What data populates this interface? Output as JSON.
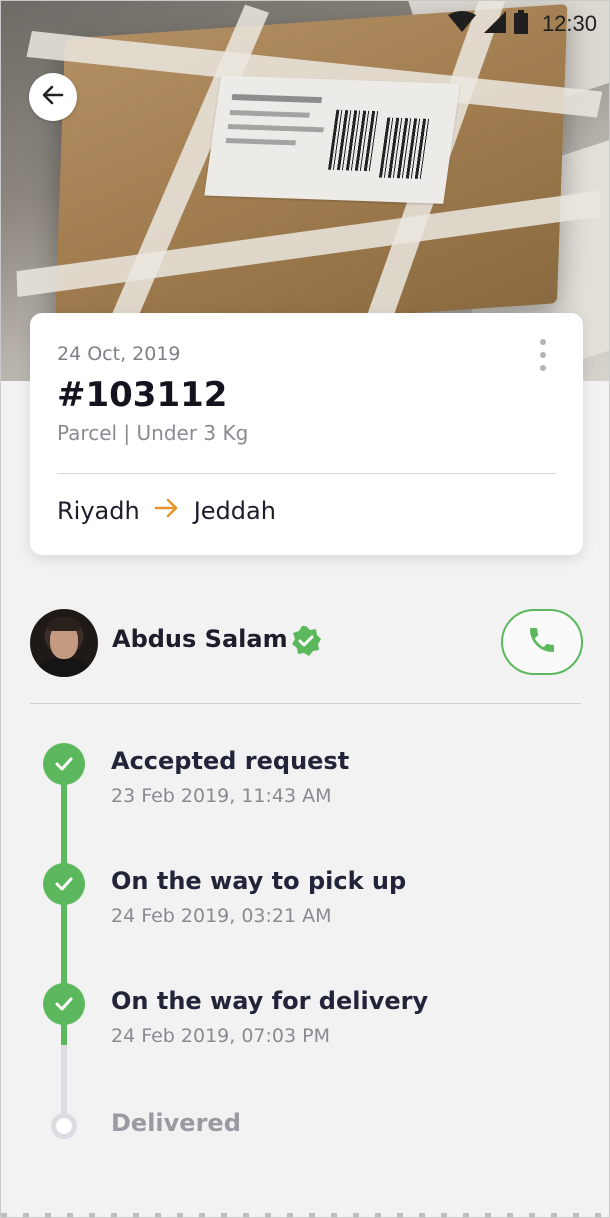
{
  "status_bar": {
    "time": "12:30",
    "icons": [
      "wifi-icon",
      "signal-icon",
      "battery-icon"
    ]
  },
  "header": {
    "back_icon": "arrow-left-icon"
  },
  "shipment": {
    "date": "24 Oct, 2019",
    "id": "#103112",
    "details": "Parcel | Under 3 Kg",
    "from": "Riyadh",
    "to": "Jeddah",
    "menu_icon": "more-vertical-icon",
    "arrow_icon": "arrow-right-icon"
  },
  "driver": {
    "name": "Abdus Salam",
    "verified_icon": "verified-badge-icon",
    "call_icon": "phone-icon"
  },
  "timeline": {
    "steps": [
      {
        "title": "Accepted request",
        "time": "23 Feb 2019, 11:43 AM",
        "done": true
      },
      {
        "title": "On the way to pick up",
        "time": "24 Feb 2019, 03:21 AM",
        "done": true
      },
      {
        "title": "On the way for delivery",
        "time": "24 Feb 2019, 07:03 PM",
        "done": true
      },
      {
        "title": "Delivered",
        "done": false
      }
    ]
  },
  "colors": {
    "accent_green": "#5cb85c",
    "accent_orange": "#e8952f",
    "background": "#f2f2f2"
  }
}
